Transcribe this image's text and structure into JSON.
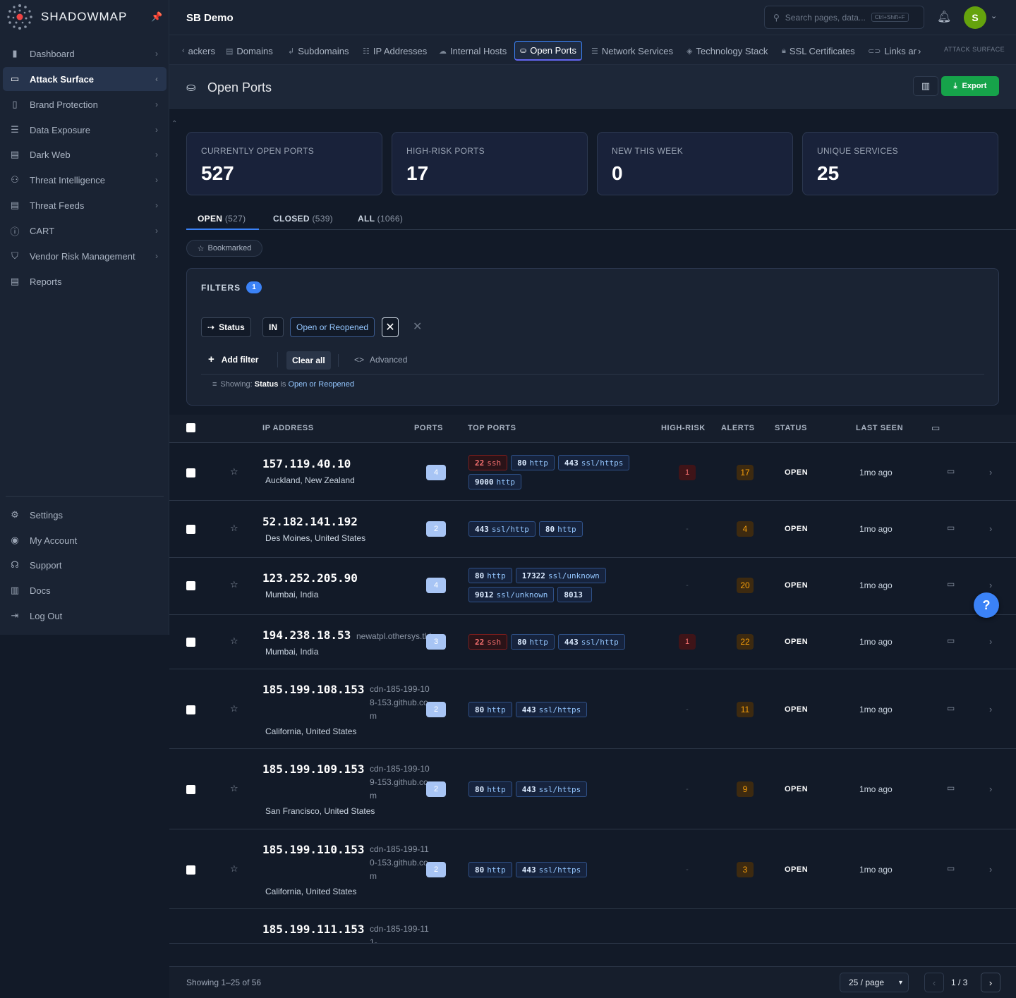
{
  "brand": {
    "name": "SHADOWMAP"
  },
  "sidebar": {
    "items": [
      {
        "label": "Dashboard",
        "icon": "bar-chart-icon"
      },
      {
        "label": "Attack Surface",
        "icon": "laptop-icon"
      },
      {
        "label": "Brand Protection",
        "icon": "building-icon"
      },
      {
        "label": "Data Exposure",
        "icon": "database-icon"
      },
      {
        "label": "Dark Web",
        "icon": "dark-web-icon"
      },
      {
        "label": "Threat Intelligence",
        "icon": "users-icon"
      },
      {
        "label": "Threat Feeds",
        "icon": "feed-icon"
      },
      {
        "label": "CART",
        "icon": "alert-circle-icon"
      },
      {
        "label": "Vendor Risk Management",
        "icon": "shield-icon"
      },
      {
        "label": "Reports",
        "icon": "report-icon"
      }
    ],
    "bottom": [
      {
        "label": "Settings",
        "icon": "gear-icon"
      },
      {
        "label": "My Account",
        "icon": "user-circle-icon"
      },
      {
        "label": "Support",
        "icon": "headset-icon"
      },
      {
        "label": "Docs",
        "icon": "book-icon"
      },
      {
        "label": "Log Out",
        "icon": "logout-icon"
      }
    ]
  },
  "header": {
    "org": "SB Demo",
    "search_placeholder": "Search pages, data...",
    "search_shortcut": "Ctrl+Shift+F",
    "avatar_initial": "S"
  },
  "tabs": [
    {
      "label": "ackers",
      "icon": "chevron-left-icon"
    },
    {
      "label": "Domains",
      "icon": "domains-icon"
    },
    {
      "label": "Subdomains",
      "icon": "subdomain-icon"
    },
    {
      "label": "IP Addresses",
      "icon": "server-icon"
    },
    {
      "label": "Internal Hosts",
      "icon": "cloud-icon"
    },
    {
      "label": "Open Ports",
      "icon": "ports-icon"
    },
    {
      "label": "Network Services",
      "icon": "network-icon"
    },
    {
      "label": "Technology Stack",
      "icon": "stack-icon"
    },
    {
      "label": "SSL Certificates",
      "icon": "lock-icon"
    },
    {
      "label": "Links ar",
      "icon": "link-icon"
    }
  ],
  "tabs_section": "ATTACK SURFACE",
  "page": {
    "title": "Open Ports",
    "export_label": "Export"
  },
  "kpis": [
    {
      "label": "CURRENTLY OPEN PORTS",
      "value": "527"
    },
    {
      "label": "HIGH-RISK PORTS",
      "value": "17"
    },
    {
      "label": "NEW THIS WEEK",
      "value": "0"
    },
    {
      "label": "UNIQUE SERVICES",
      "value": "25"
    }
  ],
  "status_tabs": [
    {
      "label": "OPEN",
      "count": "(527)"
    },
    {
      "label": "CLOSED",
      "count": "(539)"
    },
    {
      "label": "ALL",
      "count": "(1066)"
    }
  ],
  "bookmarked_label": "Bookmarked",
  "filters": {
    "title": "FILTERS",
    "count": "1",
    "field": "Status",
    "operator": "IN",
    "value": "Open or Reopened",
    "add_filter": "Add filter",
    "clear_all": "Clear all",
    "advanced": "Advanced",
    "showing_prefix": "Showing:",
    "showing_field": "Status",
    "showing_is": "is",
    "showing_value": "Open or Reopened"
  },
  "table": {
    "columns": {
      "ip": "IP ADDRESS",
      "ports": "PORTS",
      "top_ports": "TOP PORTS",
      "high_risk": "HIGH-RISK",
      "alerts": "ALERTS",
      "status": "STATUS",
      "last_seen": "LAST SEEN"
    },
    "rows": [
      {
        "ip": "157.119.40.10",
        "host": "",
        "location": "Auckland, New Zealand",
        "port_count": "4",
        "ports": [
          {
            "num": "22",
            "svc": "ssh",
            "risk": true
          },
          {
            "num": "80",
            "svc": "http",
            "risk": false
          },
          {
            "num": "443",
            "svc": "ssl/https",
            "risk": false
          },
          {
            "num": "9000",
            "svc": "http",
            "risk": false
          }
        ],
        "high_risk": "1",
        "alerts": "17",
        "status": "OPEN",
        "last_seen": "1mo ago"
      },
      {
        "ip": "52.182.141.192",
        "host": "",
        "location": "Des Moines, United States",
        "port_count": "2",
        "ports": [
          {
            "num": "443",
            "svc": "ssl/http",
            "risk": false
          },
          {
            "num": "80",
            "svc": "http",
            "risk": false
          }
        ],
        "high_risk": "-",
        "alerts": "4",
        "status": "OPEN",
        "last_seen": "1mo ago"
      },
      {
        "ip": "123.252.205.90",
        "host": "",
        "location": "Mumbai, India",
        "port_count": "4",
        "ports": [
          {
            "num": "80",
            "svc": "http",
            "risk": false
          },
          {
            "num": "17322",
            "svc": "ssl/unknown",
            "risk": false
          },
          {
            "num": "9012",
            "svc": "ssl/unknown",
            "risk": false
          },
          {
            "num": "8013",
            "svc": "",
            "risk": false
          }
        ],
        "high_risk": "-",
        "alerts": "20",
        "status": "OPEN",
        "last_seen": "1mo ago"
      },
      {
        "ip": "194.238.18.53",
        "host": "newatpl.othersys.tld",
        "location": "Mumbai, India",
        "port_count": "3",
        "ports": [
          {
            "num": "22",
            "svc": "ssh",
            "risk": true
          },
          {
            "num": "80",
            "svc": "http",
            "risk": false
          },
          {
            "num": "443",
            "svc": "ssl/http",
            "risk": false
          }
        ],
        "high_risk": "1",
        "alerts": "22",
        "status": "OPEN",
        "last_seen": "1mo ago"
      },
      {
        "ip": "185.199.108.153",
        "host": "cdn-185-199-108-153.github.com",
        "location": "California, United States",
        "port_count": "2",
        "ports": [
          {
            "num": "80",
            "svc": "http",
            "risk": false
          },
          {
            "num": "443",
            "svc": "ssl/https",
            "risk": false
          }
        ],
        "high_risk": "-",
        "alerts": "11",
        "status": "OPEN",
        "last_seen": "1mo ago"
      },
      {
        "ip": "185.199.109.153",
        "host": "cdn-185-199-109-153.github.com",
        "location": "San Francisco, United States",
        "port_count": "2",
        "ports": [
          {
            "num": "80",
            "svc": "http",
            "risk": false
          },
          {
            "num": "443",
            "svc": "ssl/https",
            "risk": false
          }
        ],
        "high_risk": "-",
        "alerts": "9",
        "status": "OPEN",
        "last_seen": "1mo ago"
      },
      {
        "ip": "185.199.110.153",
        "host": "cdn-185-199-110-153.github.com",
        "location": "California, United States",
        "port_count": "2",
        "ports": [
          {
            "num": "80",
            "svc": "http",
            "risk": false
          },
          {
            "num": "443",
            "svc": "ssl/https",
            "risk": false
          }
        ],
        "high_risk": "-",
        "alerts": "3",
        "status": "OPEN",
        "last_seen": "1mo ago"
      },
      {
        "ip": "185.199.111.153",
        "host": "cdn-185-199-111-",
        "location": "",
        "port_count": "",
        "ports": [],
        "high_risk": "",
        "alerts": "",
        "status": "",
        "last_seen": ""
      }
    ]
  },
  "footer": {
    "showing": "Showing 1–25 of 56",
    "per_page": "25 / page",
    "page_indicator": "1 / 3"
  },
  "colors": {
    "accent": "#3b82f6",
    "export": "#16a34a",
    "risk": "#f87171",
    "alert": "#f59e0b",
    "avatar": "#65a30d"
  }
}
